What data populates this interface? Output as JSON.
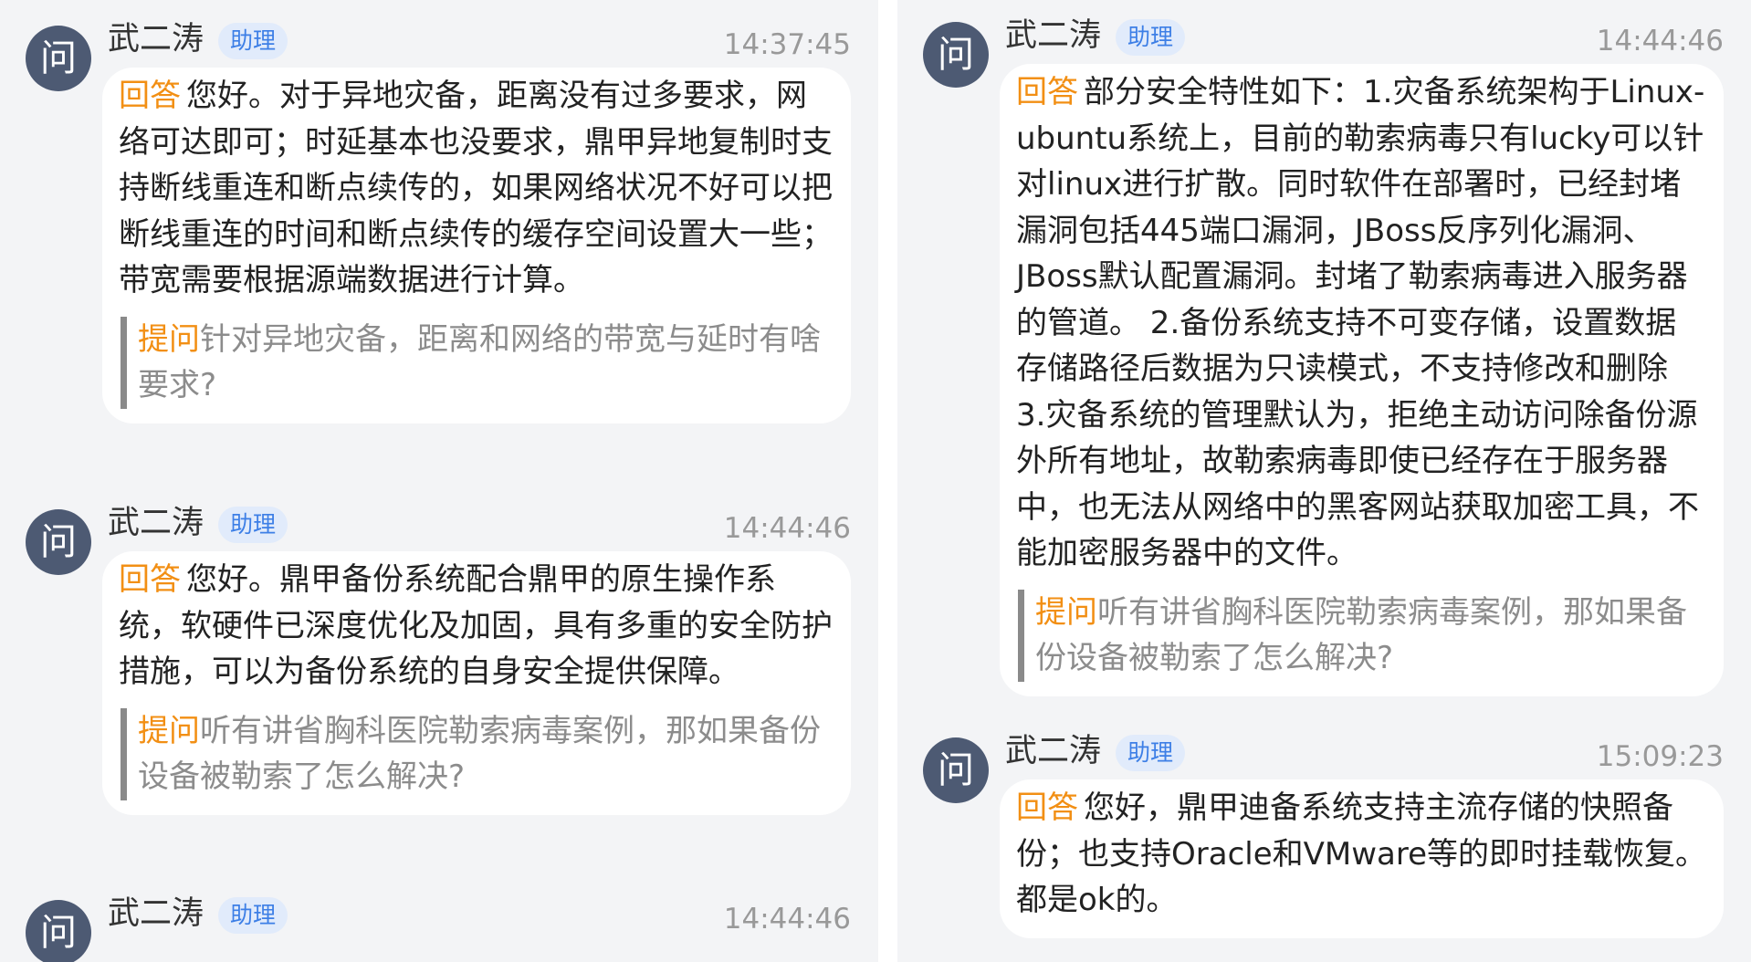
{
  "colors": {
    "background": "#f3f4f6",
    "bubble": "#ffffff",
    "avatar": "#4d5a73",
    "tag_orange": "#f28f14",
    "badge_text": "#3d7fe6",
    "badge_bg": "#e1ebfb",
    "quote_bar": "#8a8a8a",
    "time_gray": "#999999"
  },
  "left_panel": {
    "messages": [
      {
        "avatar_text": "问",
        "name": "武二涛",
        "badge": "助理",
        "time": "14:37:45",
        "answer_tag": "回答",
        "answer": "您好。对于异地灾备，距离没有过多要求，网络可达即可；时延基本也没要求，鼎甲异地复制时支持断线重连和断点续传的，如果网络状况不好可以把断线重连的时间和断点续传的缓存空间设置大一些；带宽需要根据源端数据进行计算。",
        "question_tag": "提问",
        "question": "针对异地灾备，距离和网络的带宽与延时有啥要求?"
      },
      {
        "avatar_text": "问",
        "name": "武二涛",
        "badge": "助理",
        "time": "14:44:46",
        "answer_tag": "回答",
        "answer": "您好。鼎甲备份系统配合鼎甲的原生操作系统，软硬件已深度优化及加固，具有多重的安全防护措施，可以为备份系统的自身安全提供保障。",
        "question_tag": "提问",
        "question": "听有讲省胸科医院勒索病毒案例，那如果备份设备被勒索了怎么解决?"
      },
      {
        "avatar_text": "问",
        "name": "武二涛",
        "badge": "助理",
        "time": "14:44:46"
      }
    ]
  },
  "right_panel": {
    "messages": [
      {
        "avatar_text": "问",
        "name": "武二涛",
        "badge": "助理",
        "time": "14:44:46",
        "answer_tag": "回答",
        "answer": "部分安全特性如下：1.灾备系统架构于Linux-ubuntu系统上，目前的勒索病毒只有lucky可以针对linux进行扩散。同时软件在部署时，已经封堵漏洞包括445端口漏洞，JBoss反序列化漏洞、JBoss默认配置漏洞。封堵了勒索病毒进入服务器的管道。 2.备份系统支持不可变存储，设置数据存储路径后数据为只读模式，不支持修改和删除 3.灾备系统的管理默认为，拒绝主动访问除备份源外所有地址，故勒索病毒即使已经存在于服务器中，也无法从网络中的黑客网站获取加密工具，不能加密服务器中的文件。",
        "question_tag": "提问",
        "question": "听有讲省胸科医院勒索病毒案例，那如果备份设备被勒索了怎么解决?"
      },
      {
        "avatar_text": "问",
        "name": "武二涛",
        "badge": "助理",
        "time": "15:09:23",
        "answer_tag": "回答",
        "answer": "您好，鼎甲迪备系统支持主流存储的快照备份；也支持Oracle和VMware等的即时挂载恢复。都是ok的。"
      }
    ]
  }
}
